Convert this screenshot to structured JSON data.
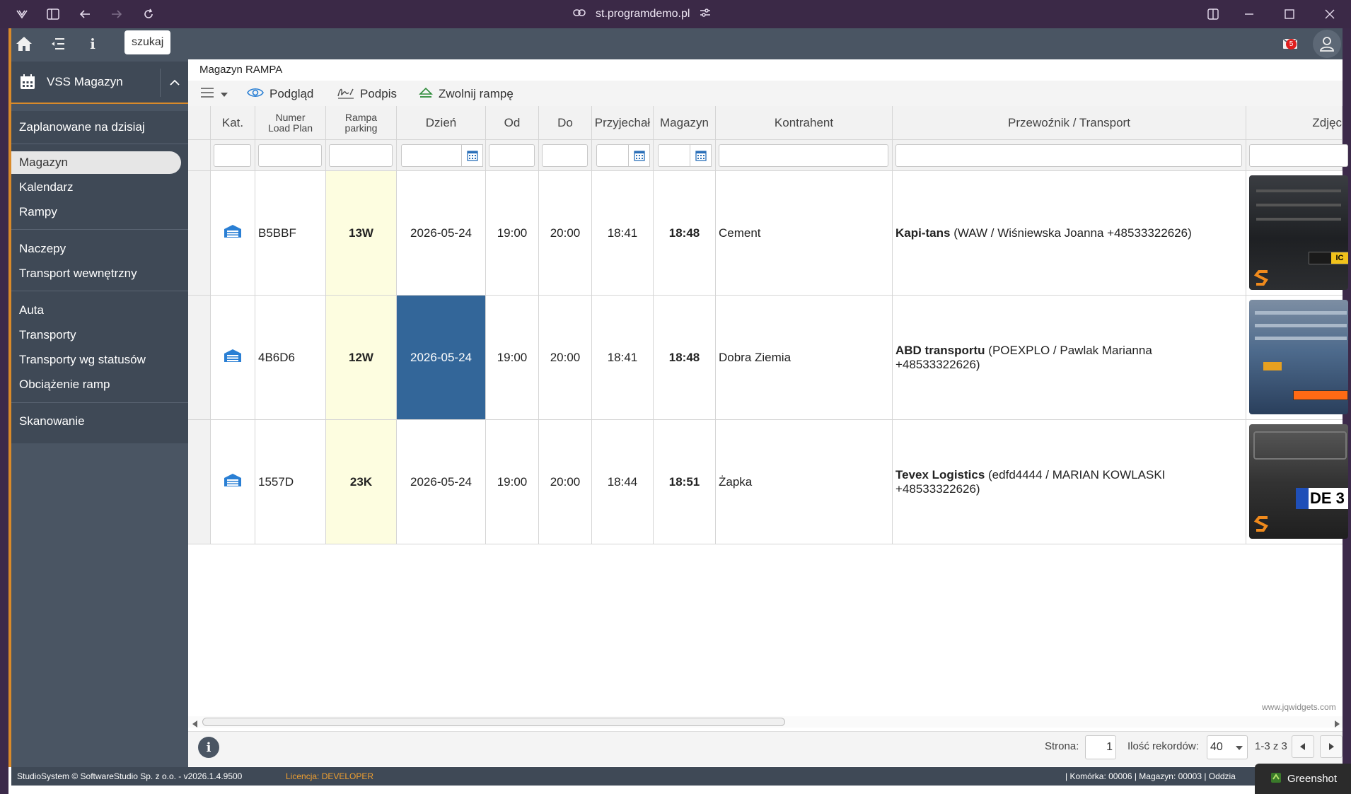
{
  "browser": {
    "url": "st.programdemo.pl"
  },
  "topbar": {
    "search_label": "szukaj",
    "mail_count": "5"
  },
  "sidebar": {
    "module_title": "VSS Magazyn",
    "items": [
      {
        "label": "Zaplanowane na dzisiaj"
      },
      {
        "label": "Magazyn"
      },
      {
        "label": "Kalendarz"
      },
      {
        "label": "Rampy"
      },
      {
        "label": "Naczepy"
      },
      {
        "label": "Transport wewnętrzny"
      },
      {
        "label": "Auta"
      },
      {
        "label": "Transporty"
      },
      {
        "label": "Transporty wg statusów"
      },
      {
        "label": "Obciążenie ramp"
      },
      {
        "label": "Skanowanie"
      }
    ]
  },
  "content": {
    "title": "Magazyn RAMPA",
    "toolbar": {
      "view_label": "Podgląd",
      "sign_label": "Podpis",
      "release_label": "Zwolnij rampę"
    }
  },
  "grid": {
    "columns": [
      {
        "label": "Kat."
      },
      {
        "label1": "Numer",
        "label2": "Load Plan"
      },
      {
        "label1": "Rampa",
        "label2": "parking"
      },
      {
        "label": "Dzień"
      },
      {
        "label": "Od"
      },
      {
        "label": "Do"
      },
      {
        "label": "Przyjechał"
      },
      {
        "label": "Magazyn"
      },
      {
        "label": "Kontrahent"
      },
      {
        "label": "Przewoźnik / Transport"
      },
      {
        "label": "Zdjęc"
      }
    ],
    "rows": [
      {
        "number": "B5BBF",
        "ramp": "13W",
        "day": "2026-05-24",
        "from": "19:00",
        "to": "20:00",
        "arrived": "18:41",
        "warehouse": "18:48",
        "contractor": "Cement",
        "carrier_name": "Kapi-tans",
        "carrier_details": " (WAW / Wiśniewska Joanna +48533322626)",
        "photo_text": "IC"
      },
      {
        "number": "4B6D6",
        "ramp": "12W",
        "day": "2026-05-24",
        "from": "19:00",
        "to": "20:00",
        "arrived": "18:41",
        "warehouse": "18:48",
        "contractor": "Dobra Ziemia",
        "carrier_name": "ABD transportu",
        "carrier_details": " (POEXPLO / Pawlak Marianna +48533322626)",
        "photo_text": ""
      },
      {
        "number": "1557D",
        "ramp": "23K",
        "day": "2026-05-24",
        "from": "19:00",
        "to": "20:00",
        "arrived": "18:44",
        "warehouse": "18:51",
        "contractor": "Żapka",
        "carrier_name": "Tevex Logistics",
        "carrier_details": " (edfd4444 / MARIAN KOWLASKI +48533322626)",
        "photo_text": "DE 3"
      }
    ],
    "watermark": "www.jqwidgets.com"
  },
  "pager": {
    "page_label": "Strona:",
    "page_value": "1",
    "records_label": "Ilość rekordów:",
    "records_value": "40",
    "range": "1-3 z 3"
  },
  "footer": {
    "copyright": "StudioSystem © SoftwareStudio Sp. z o.o. - v2026.1.4.9500",
    "license": "Licencja: DEVELOPER",
    "status": "| Komórka: 00006 | Magazyn: 00003 | Oddzia"
  },
  "taskbar": {
    "greenshot": "Greenshot"
  },
  "colors": {
    "sidebar": "#4a5563",
    "accent": "#d98a2a",
    "selected_cell": "#336699",
    "ramp_highlight": "#fdfde0",
    "category_icon": "#2a7fd4"
  }
}
